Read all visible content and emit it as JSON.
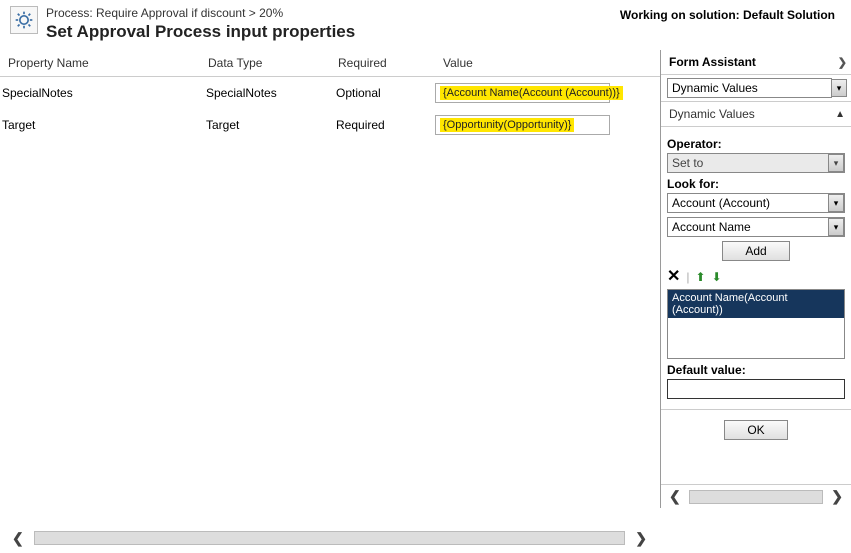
{
  "header": {
    "process_prefix": "Process: ",
    "process_name": "Require Approval if discount > 20%",
    "title": "Set Approval Process input properties",
    "working_on_prefix": "Working on solution: ",
    "solution": "Default Solution"
  },
  "columns": {
    "name": "Property Name",
    "type": "Data Type",
    "required": "Required",
    "value": "Value"
  },
  "rows": [
    {
      "name": "SpecialNotes",
      "type": "SpecialNotes",
      "required": "Optional",
      "value": "{Account Name(Account (Account))}"
    },
    {
      "name": "Target",
      "type": "Target",
      "required": "Required",
      "value": "{Opportunity(Opportunity)}"
    }
  ],
  "assistant": {
    "title": "Form Assistant",
    "dropdown": "Dynamic Values",
    "section": "Dynamic Values",
    "operator_label": "Operator:",
    "operator_value": "Set to",
    "lookfor_label": "Look for:",
    "lookfor_entity": "Account (Account)",
    "lookfor_attr": "Account Name",
    "add": "Add",
    "list_item": "Account Name(Account (Account))",
    "default_label": "Default value:",
    "default_value": "",
    "ok": "OK"
  }
}
